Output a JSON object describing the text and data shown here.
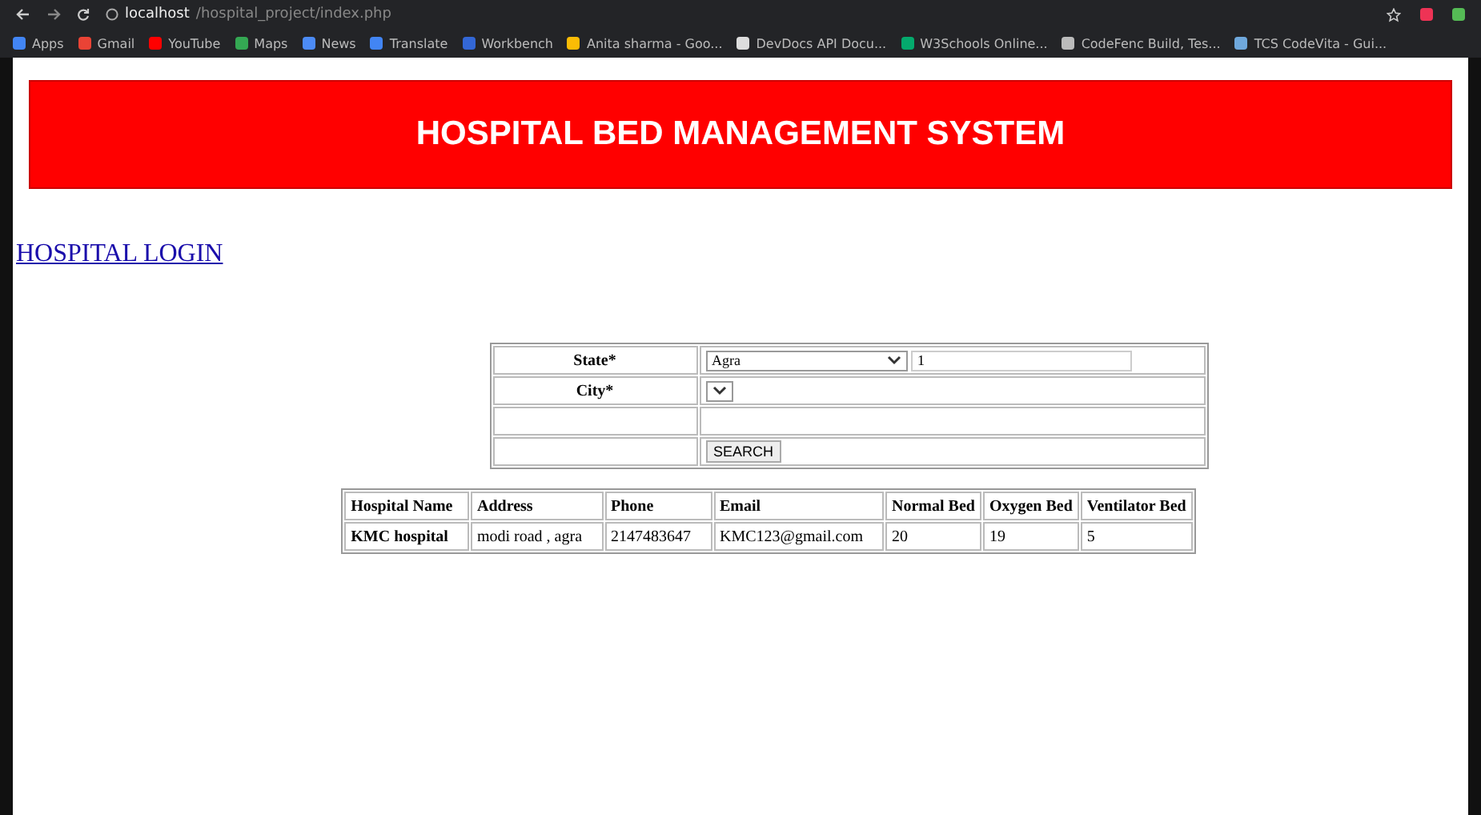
{
  "browser": {
    "url_host": "localhost",
    "url_path": "/hospital_project/index.php",
    "bookmarks": [
      {
        "label": "Apps",
        "color": "#4285f4"
      },
      {
        "label": "Gmail",
        "color": "#ea4335"
      },
      {
        "label": "YouTube",
        "color": "#ff0000"
      },
      {
        "label": "Maps",
        "color": "#34a853"
      },
      {
        "label": "News",
        "color": "#4c8bf5"
      },
      {
        "label": "Translate",
        "color": "#4285f4"
      },
      {
        "label": "Workbench",
        "color": "#3367d6"
      },
      {
        "label": "Anita sharma - Goo...",
        "color": "#fbbc05"
      },
      {
        "label": "DevDocs API Docu...",
        "color": "#dddddd"
      },
      {
        "label": "W3Schools Online...",
        "color": "#04aa6d"
      },
      {
        "label": "CodeFenc Build, Tes...",
        "color": "#bbbbbb"
      },
      {
        "label": "TCS CodeVita - Gui...",
        "color": "#6fa8dc"
      }
    ]
  },
  "header": {
    "title": "HOSPITAL BED MANAGEMENT SYSTEM"
  },
  "login_link": "HOSPITAL LOGIN",
  "search_form": {
    "state_label": "State*",
    "state_value": "Agra",
    "state_extra_value": "1",
    "city_label": "City*",
    "search_button": "SEARCH"
  },
  "table": {
    "columns": [
      "Hospital Name",
      "Address",
      "Phone",
      "Email",
      "Normal Bed",
      "Oxygen Bed",
      "Ventilator Bed"
    ],
    "rows": [
      [
        "KMC hospital",
        "modi road , agra",
        "2147483647",
        "KMC123@gmail.com",
        "20",
        "19",
        "5"
      ]
    ]
  }
}
